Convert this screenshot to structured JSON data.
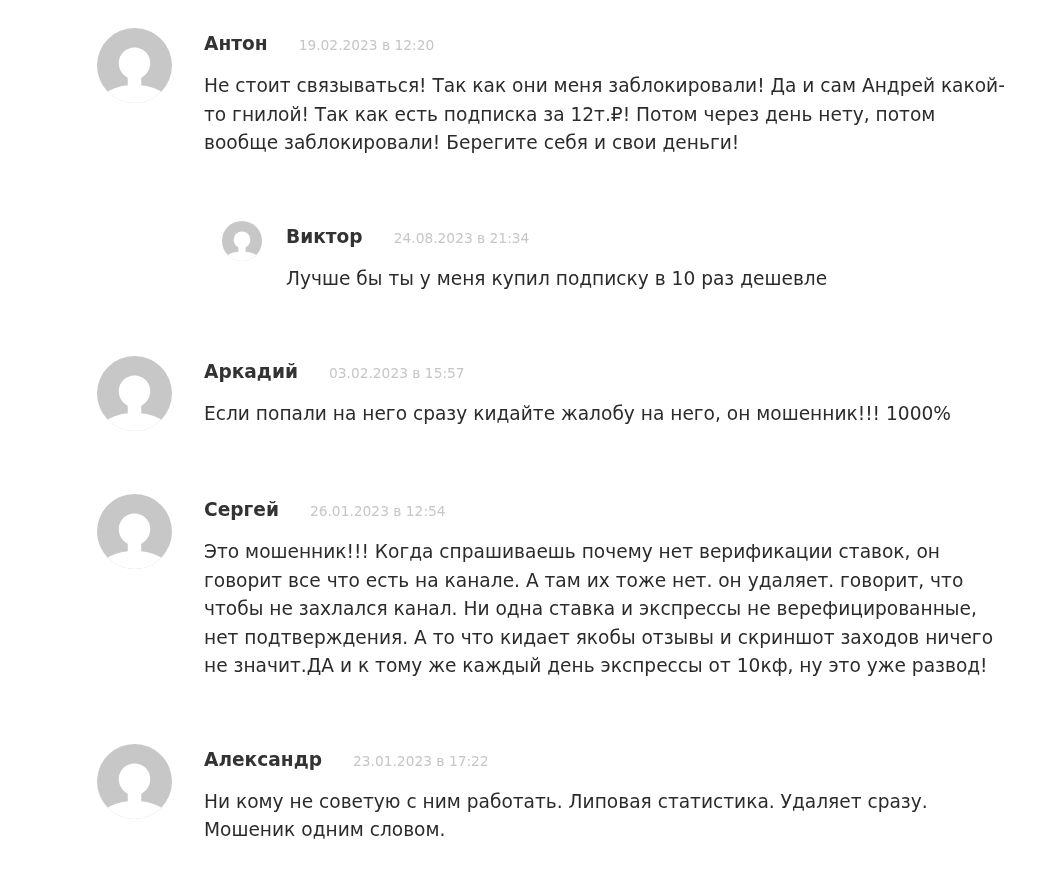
{
  "comments": [
    {
      "author": "Антон",
      "date": "19.02.2023 в 12:20",
      "text": "Не стоит связываться! Так как они меня заблокировали! Да и сам Андрей какой-то гнилой! Так как есть подписка за 12т.₽! Потом через день нету, потом вообще заблокировали! Берегите себя и свои деньги!",
      "children": [
        {
          "author": "Виктор",
          "date": "24.08.2023 в 21:34",
          "text": "Лучше бы ты у меня купил подписку в 10 раз дешевле"
        }
      ]
    },
    {
      "author": "Аркадий",
      "date": "03.02.2023 в 15:57",
      "text": "Если попали на него сразу кидайте жалобу на него, он мошенник!!! 1000%"
    },
    {
      "author": "Сергей",
      "date": "26.01.2023 в 12:54",
      "text": "Это мошенник!!! Когда спрашиваешь почему нет верификации ставок, он говорит все что есть на канале. А там их тоже нет. он удаляет. говорит, что чтобы не захлался канал. Ни одна ставка и экспрессы не верефицированные, нет подтверждения. А то что кидает якобы отзывы и скриншот заходов ничего не значит.ДА и к тому же каждый день экспрессы от 10кф, ну это уже развод!"
    },
    {
      "author": "Александр",
      "date": "23.01.2023 в 17:22",
      "text": "Ни кому не советую с ним работать. Липовая статистика. Удаляет сразу. Мошеник одним словом."
    }
  ]
}
